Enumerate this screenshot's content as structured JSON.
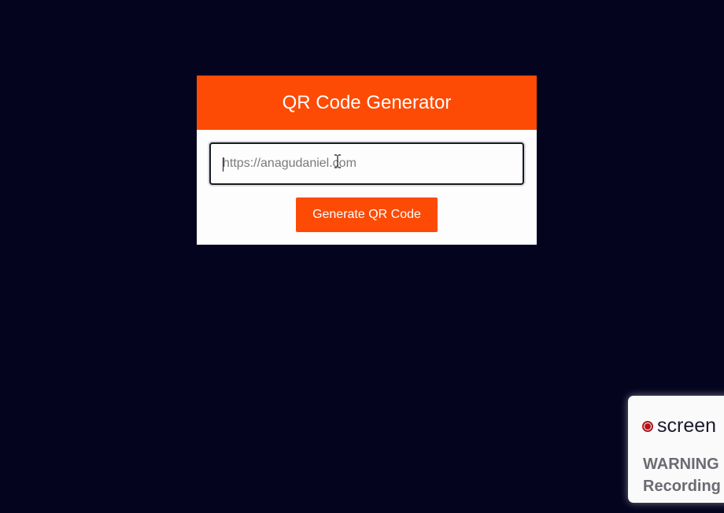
{
  "app": {
    "title": "QR Code Generator"
  },
  "form": {
    "url_placeholder": "https://anagudaniel.com",
    "url_value": "",
    "generate_label": "Generate QR Code"
  },
  "recorder": {
    "brand": "screen",
    "warning": "WARNING",
    "subtext": "Recording"
  },
  "colors": {
    "background": "#04041f",
    "accent": "#fd4b05",
    "card": "#fdfdfd",
    "recorder_dot": "#b3141c"
  },
  "icons": {
    "text_cursor": "i-beam-cursor-icon",
    "record": "record-dot-icon"
  }
}
